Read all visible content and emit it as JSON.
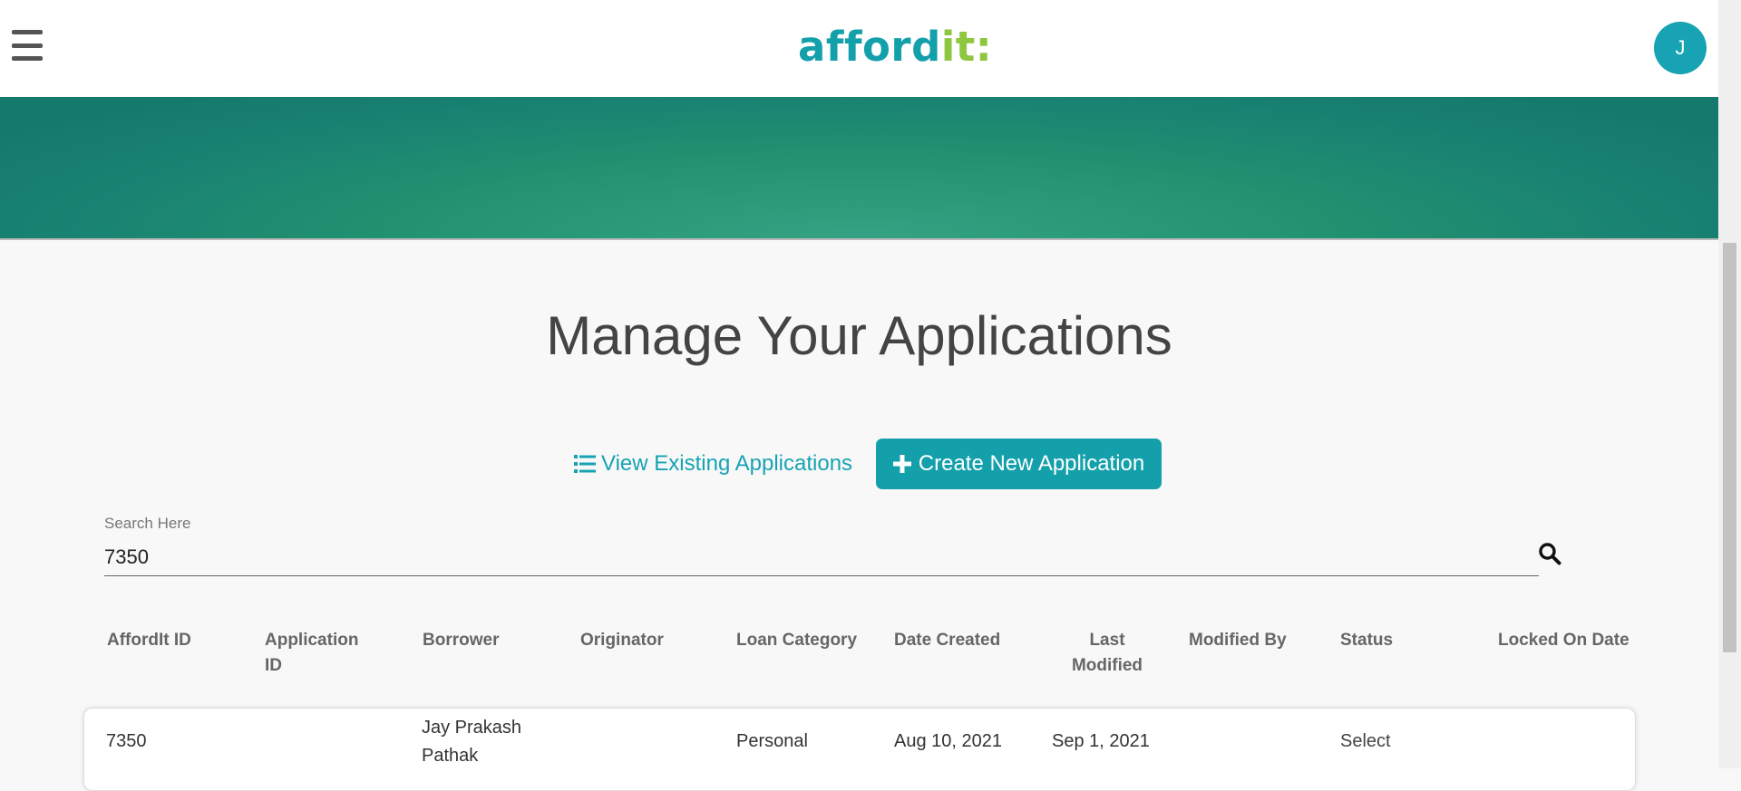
{
  "header": {
    "logo_part1": "afford",
    "logo_part2": "it:",
    "avatar_initial": "J",
    "brand_color": "#14a0ab",
    "accent_color": "#8dc63f"
  },
  "main": {
    "title": "Manage Your Applications",
    "view_existing_label": "View Existing Applications",
    "create_new_label": "Create New Application"
  },
  "search": {
    "label": "Search Here",
    "value": "7350"
  },
  "table": {
    "headers": {
      "affordit_id": "AffordIt ID",
      "application_id": "Application ID",
      "borrower": "Borrower",
      "originator": "Originator",
      "loan_category": "Loan Category",
      "date_created": "Date Created",
      "last_modified": "Last Modified",
      "modified_by": "Modified By",
      "status": "Status",
      "locked_on_date": "Locked On Date"
    },
    "rows": [
      {
        "affordit_id": "7350",
        "application_id": "",
        "borrower": "Jay Prakash Pathak",
        "originator": "",
        "loan_category": "Personal",
        "date_created": "Aug 10, 2021",
        "last_modified": "Sep 1, 2021",
        "modified_by": "",
        "status": "Select",
        "locked_on_date": ""
      }
    ]
  }
}
